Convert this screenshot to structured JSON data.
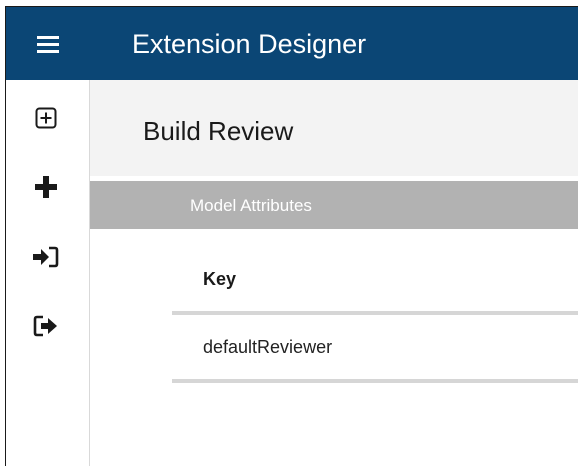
{
  "header": {
    "app_title": "Extension Designer",
    "menu_icon": "hamburger-menu-icon",
    "color": "#0b4675"
  },
  "sidebar": {
    "items": [
      {
        "icon": "plus-square-icon"
      },
      {
        "icon": "plus-icon"
      },
      {
        "icon": "sign-in-icon"
      },
      {
        "icon": "sign-out-icon"
      }
    ]
  },
  "page": {
    "title": "Build Review"
  },
  "section": {
    "title": "Model Attributes"
  },
  "table": {
    "headers": [
      "Key"
    ],
    "rows": [
      [
        "defaultReviewer"
      ]
    ]
  }
}
